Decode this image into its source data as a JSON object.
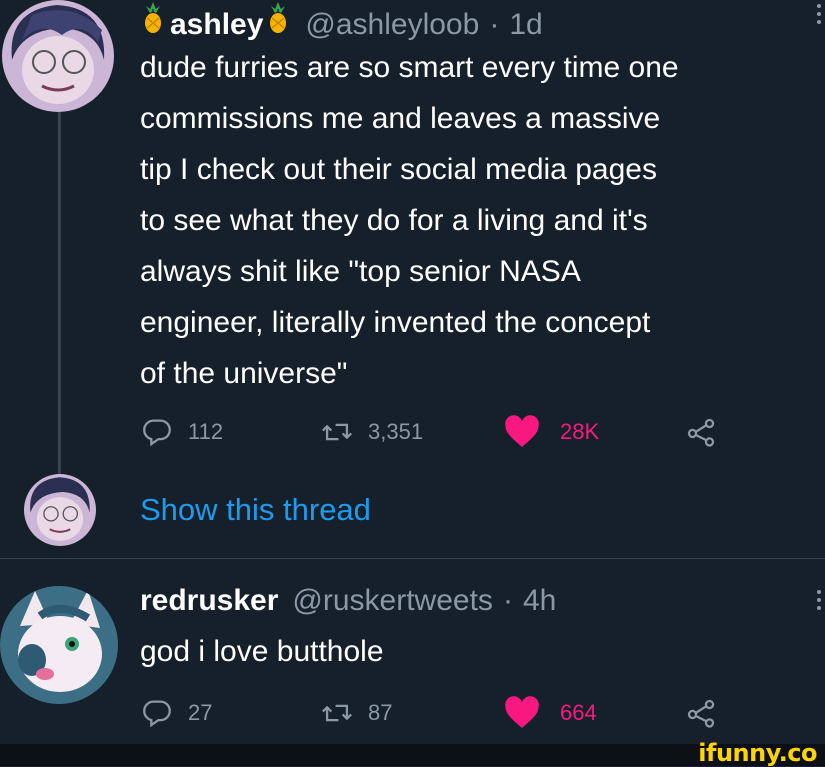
{
  "tweet1": {
    "display_name": "ashley",
    "handle": "@ashleyloob",
    "separator": "·",
    "time": "1d",
    "lines": [
      "dude furries are so smart every time one",
      "commissions me and leaves a massive",
      "tip I check out their social media pages",
      "to see what they do for a living and it's",
      "always shit like \"top senior NASA",
      "engineer, literally invented the concept",
      "of the universe\""
    ],
    "replies": "112",
    "retweets": "3,351",
    "likes": "28K",
    "liked": true,
    "name_emoji_icon": "pineapple-icon"
  },
  "show_thread": "Show this thread",
  "tweet2": {
    "display_name": "redrusker",
    "handle": "@ruskertweets",
    "separator": "·",
    "time": "4h",
    "text": "god i love butthole",
    "replies": "27",
    "retweets": "87",
    "likes": "664",
    "liked": true
  },
  "watermark": "ifunny.co",
  "colors": {
    "background": "#15202b",
    "text": "#ffffff",
    "secondary": "#8b98a5",
    "link": "#1d9bf0",
    "like": "#f91880",
    "watermark": "#ffd400"
  }
}
